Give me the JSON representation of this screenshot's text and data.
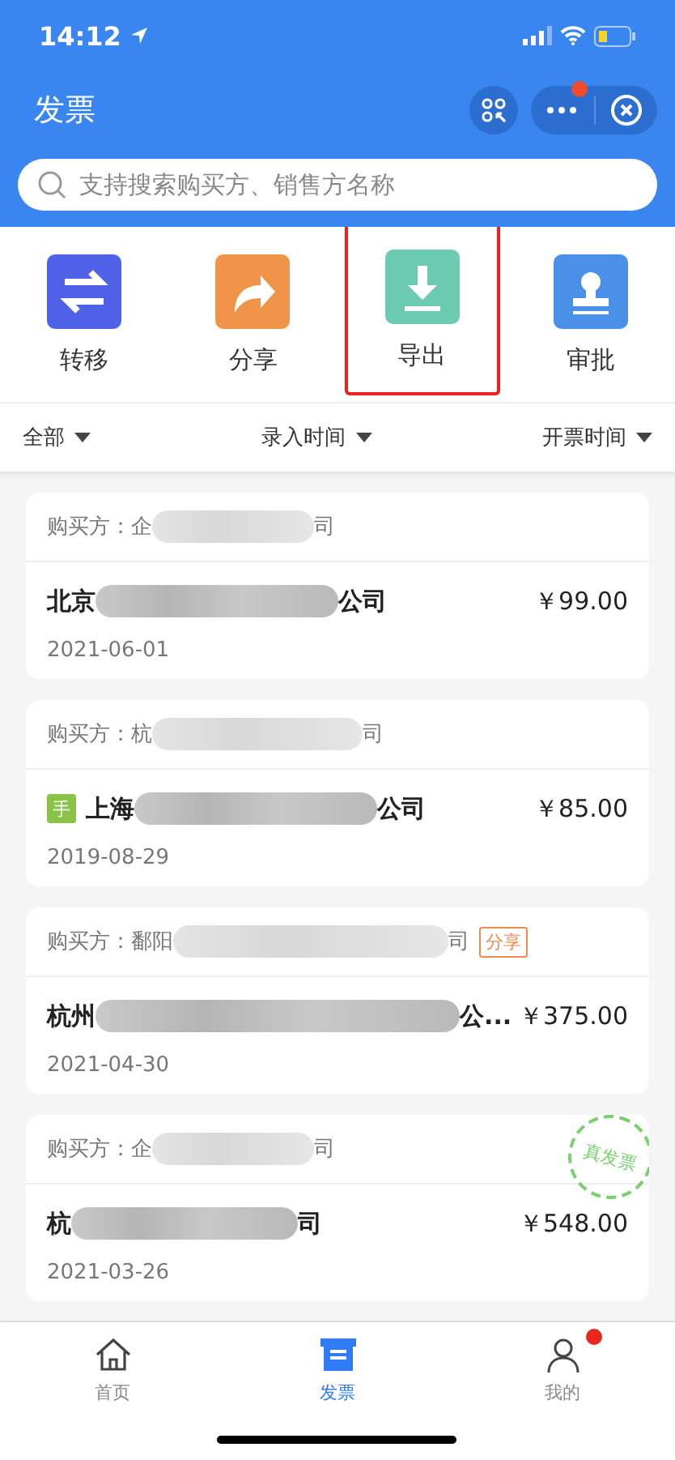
{
  "status_bar": {
    "time": "14:12"
  },
  "header": {
    "title": "发票",
    "menu_badge": true
  },
  "search": {
    "placeholder": "支持搜索购买方、销售方名称"
  },
  "actions": [
    {
      "label": "转移",
      "kind": "transfer",
      "highlighted": false
    },
    {
      "label": "分享",
      "kind": "share",
      "highlighted": false
    },
    {
      "label": "导出",
      "kind": "export",
      "highlighted": true
    },
    {
      "label": "审批",
      "kind": "approve",
      "highlighted": false
    }
  ],
  "filters": [
    "全部",
    "录入时间",
    "开票时间"
  ],
  "invoices": [
    {
      "buyer_start": "购买方：企",
      "buyer_end": "司",
      "manual": false,
      "seller_start": "北京",
      "seller_end": "公司",
      "amount": "￥99.00",
      "date": "2021-06-01"
    },
    {
      "buyer_start": "购买方：杭",
      "buyer_end": "司",
      "manual": true,
      "manual_label": "手",
      "seller_start": "上海",
      "seller_end": "公司",
      "amount": "￥85.00",
      "date": "2019-08-29"
    },
    {
      "buyer_start": "购买方：鄱阳",
      "buyer_end": "司",
      "tag": "分享",
      "manual": false,
      "seller_start": "杭州",
      "seller_end": "公...",
      "amount": "￥375.00",
      "date": "2021-04-30"
    },
    {
      "buyer_start": "购买方：企",
      "buyer_end": "司",
      "manual": false,
      "seller_start": "杭",
      "seller_end": "司",
      "amount": "￥548.00",
      "date": "2021-03-26",
      "stamp": "真发票"
    }
  ],
  "tabbar": [
    {
      "label": "首页",
      "kind": "home",
      "selected": false,
      "badge": false
    },
    {
      "label": "发票",
      "kind": "invoice",
      "selected": true,
      "badge": false
    },
    {
      "label": "我的",
      "kind": "profile",
      "selected": false,
      "badge": true
    }
  ]
}
